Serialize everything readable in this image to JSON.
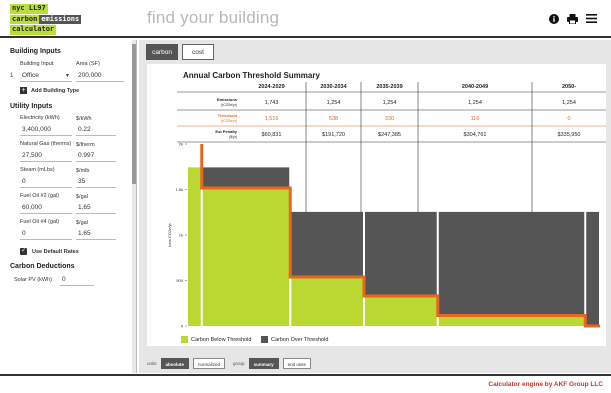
{
  "header": {
    "logo": [
      "nyc LL97",
      "carbon",
      "emissions",
      "calculator"
    ],
    "tagline": "find your building"
  },
  "sidebar": {
    "building_inputs_title": "Building Inputs",
    "col_building_input": "Building Input",
    "col_area": "Area (SF)",
    "building_index": "1",
    "building_type": "Office",
    "building_area": "200,000",
    "add_building_type": "Add Building Type",
    "utility_title": "Utility Inputs",
    "utilities": [
      {
        "label": "Electricity (kWh)",
        "value": "3,400,000",
        "rate_label": "$/kWh",
        "rate": "0.22"
      },
      {
        "label": "Natural Gas (therms)",
        "value": "27,500",
        "rate_label": "$/therm",
        "rate": "0.997"
      },
      {
        "label": "Steam (mLbs)",
        "value": "0",
        "rate_label": "$/mlb",
        "rate": "35"
      },
      {
        "label": "Fuel Oil #2 (gal)",
        "value": "60,000",
        "rate_label": "$/gal",
        "rate": "1.65"
      },
      {
        "label": "Fuel Oil #4 (gal)",
        "value": "0",
        "rate_label": "$/gal",
        "rate": "1.65"
      }
    ],
    "use_default_rates": "Use Default Rates",
    "deductions_title": "Carbon Deductions",
    "solar_label": "Solar PV (kWh)",
    "solar_value": "0"
  },
  "main": {
    "tabs": [
      "carbon",
      "cost"
    ],
    "chart_title": "Annual Carbon Threshold Summary",
    "periods": [
      "2024-2029",
      "2030-2034",
      "2035-2039",
      "2040-2049",
      "2050-"
    ],
    "row_emissions": {
      "label": "Emissions",
      "unit": "(tCO2e/yr)",
      "values": [
        "1,743",
        "1,254",
        "1,254",
        "1,254",
        "1,254"
      ]
    },
    "row_threshold": {
      "label": "Threshold",
      "unit": "(tCO2e/yr)",
      "values": [
        "1,516",
        "538",
        "330",
        "116",
        "0"
      ]
    },
    "row_penalty": {
      "label": "Est Penalty",
      "unit": "($/yr)",
      "values": [
        "$60,831",
        "$191,720",
        "$247,385",
        "$304,761",
        "$335,950"
      ]
    },
    "legend_below": "Carbon Below Threshold",
    "legend_over": "Carbon Over Threshold",
    "controls": {
      "units_label": "units",
      "units": [
        "absolute",
        "normalized"
      ],
      "group_label": "group",
      "group": [
        "summary",
        "end uses"
      ]
    }
  },
  "footer": {
    "credit_prefix": "Calculator engine by ",
    "credit_company": "AKF Group LLC"
  },
  "chart_data": {
    "type": "area",
    "ylabel": "tons CO2e/yr",
    "ytick_labels": [
      "0",
      "500",
      "1k",
      "1.5k",
      "2k"
    ],
    "ylim": [
      0,
      2000
    ],
    "xlim": [
      2023,
      2051
    ],
    "emissions_steps": [
      {
        "x0": 2023,
        "x1": 2024,
        "value": 1743
      },
      {
        "x0": 2024,
        "x1": 2030,
        "value": 1743
      },
      {
        "x0": 2030,
        "x1": 2035,
        "value": 1254
      },
      {
        "x0": 2035,
        "x1": 2040,
        "value": 1254
      },
      {
        "x0": 2040,
        "x1": 2050,
        "value": 1254
      },
      {
        "x0": 2050,
        "x1": 2051,
        "value": 1254
      }
    ],
    "threshold_steps": [
      {
        "x0": 2024,
        "x1": 2030,
        "value": 1516
      },
      {
        "x0": 2030,
        "x1": 2035,
        "value": 538
      },
      {
        "x0": 2035,
        "x1": 2040,
        "value": 330
      },
      {
        "x0": 2040,
        "x1": 2050,
        "value": 116
      },
      {
        "x0": 2050,
        "x1": 2051,
        "value": 0
      }
    ],
    "colors": {
      "below": "#b9d832",
      "over": "#555555",
      "threshold": "#e8661f"
    },
    "legend": "bottom"
  }
}
